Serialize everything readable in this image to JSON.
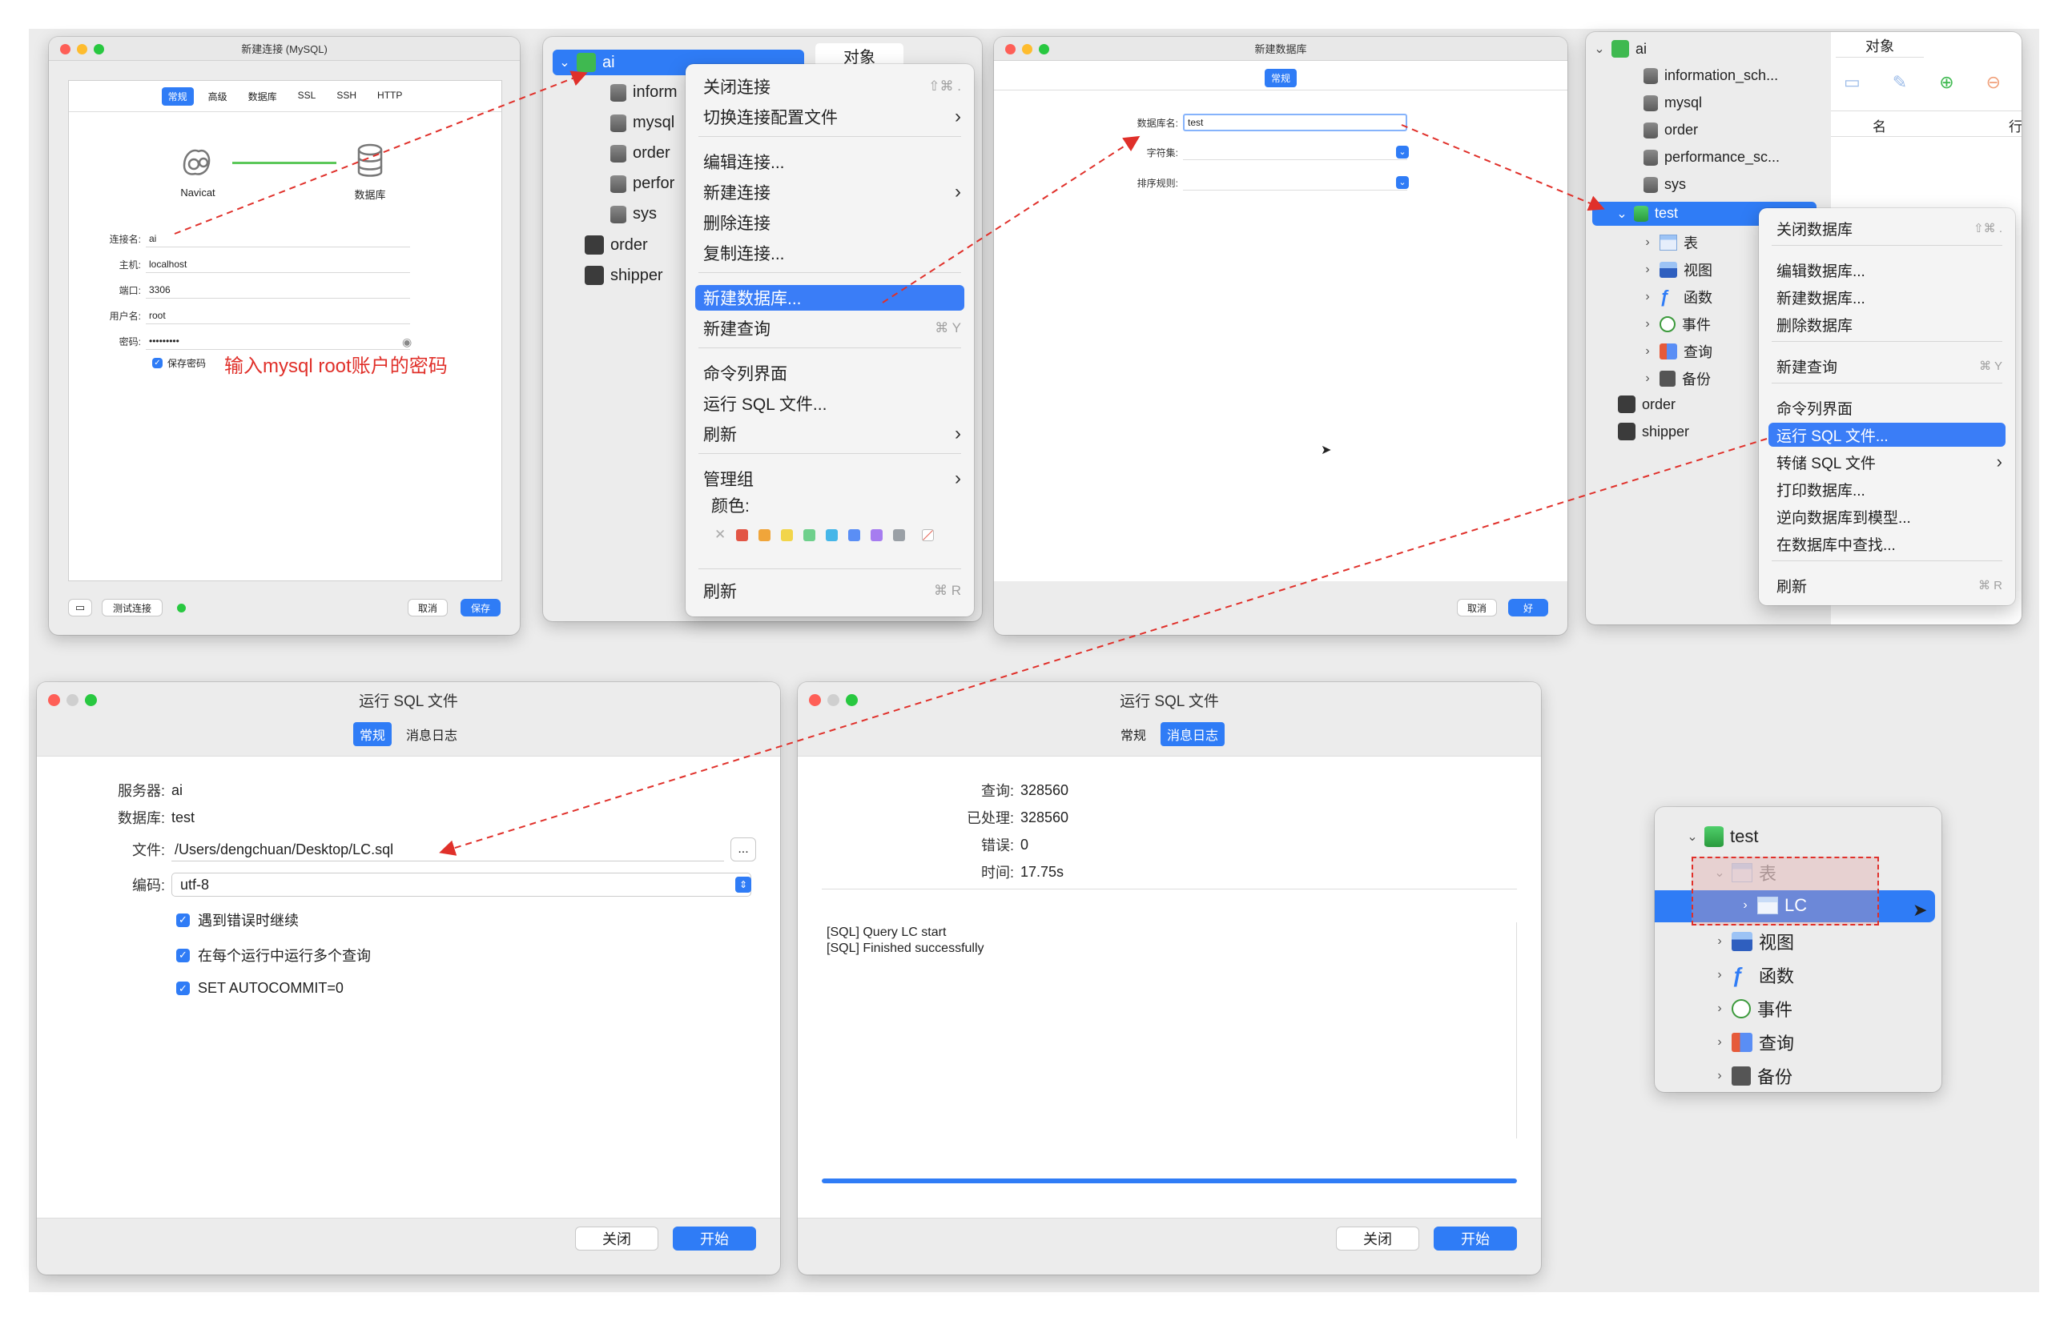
{
  "conn_dialog": {
    "title": "新建连接 (MySQL)",
    "tabs": [
      "常规",
      "高级",
      "数据库",
      "SSL",
      "SSH",
      "HTTP"
    ],
    "navicat_label": "Navicat",
    "db_label": "数据库",
    "fields": [
      {
        "label": "连接名:",
        "value": "ai"
      },
      {
        "label": "主机:",
        "value": "localhost"
      },
      {
        "label": "端口:",
        "value": "3306"
      },
      {
        "label": "用户名:",
        "value": "root"
      },
      {
        "label": "密码:",
        "value": "•••••••••"
      }
    ],
    "save_password": "保存密码",
    "annotation": "输入mysql root账户的密码",
    "test_button": "测试连接",
    "cancel_button": "取消",
    "save_button": "保存"
  },
  "tree1": {
    "root": "ai",
    "children": [
      "inform",
      "mysql",
      "order",
      "perfor",
      "sys"
    ],
    "others": [
      "order",
      "shipper"
    ],
    "tab": "对象"
  },
  "menu1": {
    "items": [
      {
        "label": "关闭连接",
        "shortcut": "⇧⌘ ."
      },
      {
        "label": "切换连接配置文件",
        "shortcut": "›"
      },
      {
        "label": "编辑连接...",
        "shortcut": ""
      },
      {
        "label": "新建连接",
        "shortcut": "›"
      },
      {
        "label": "删除连接",
        "shortcut": ""
      },
      {
        "label": "复制连接...",
        "shortcut": ""
      },
      {
        "label": "新建数据库...",
        "shortcut": ""
      },
      {
        "label": "新建查询",
        "shortcut": "⌘ Y"
      },
      {
        "label": "命令列界面",
        "shortcut": ""
      },
      {
        "label": "运行 SQL 文件...",
        "shortcut": ""
      },
      {
        "label": "刷新",
        "shortcut": "›"
      },
      {
        "label": "管理组",
        "shortcut": "›"
      }
    ],
    "color_label": "颜色:",
    "refresh": "刷新",
    "refresh_shortcut": "⌘ R",
    "colors": [
      "#e25545",
      "#f0a53a",
      "#f2d54a",
      "#6fd08c",
      "#45b6e8",
      "#5a8ef5",
      "#a67cf0",
      "#9aa0a6"
    ]
  },
  "newdb_dialog": {
    "title": "新建数据库",
    "tab": "常规",
    "fields": [
      {
        "label": "数据库名:",
        "value": "test"
      },
      {
        "label": "字符集:",
        "value": ""
      },
      {
        "label": "排序规则:",
        "value": ""
      }
    ],
    "cancel_button": "取消",
    "ok_button": "好"
  },
  "tree2": {
    "root": "ai",
    "children": [
      "information_sch...",
      "mysql",
      "order",
      "performance_sc...",
      "sys"
    ],
    "selected": "test",
    "sub": [
      "表",
      "视图",
      "函数",
      "事件",
      "查询",
      "备份"
    ],
    "others": [
      "order",
      "shipper"
    ],
    "tab": "对象",
    "col_name": "名",
    "col_row": "行"
  },
  "menu2": {
    "items": [
      {
        "label": "关闭数据库",
        "shortcut": "⇧⌘ ."
      },
      {
        "label": "编辑数据库...",
        "shortcut": ""
      },
      {
        "label": "新建数据库...",
        "shortcut": ""
      },
      {
        "label": "删除数据库",
        "shortcut": ""
      },
      {
        "label": "新建查询",
        "shortcut": "⌘ Y"
      },
      {
        "label": "命令列界面",
        "shortcut": ""
      },
      {
        "label": "运行 SQL 文件...",
        "shortcut": ""
      },
      {
        "label": "转储 SQL 文件",
        "shortcut": "›"
      },
      {
        "label": "打印数据库...",
        "shortcut": ""
      },
      {
        "label": "逆向数据库到模型...",
        "shortcut": ""
      },
      {
        "label": "在数据库中查找...",
        "shortcut": ""
      },
      {
        "label": "刷新",
        "shortcut": "⌘ R"
      }
    ]
  },
  "run_sql_1": {
    "title": "运行 SQL 文件",
    "tabs": [
      "常规",
      "消息日志"
    ],
    "server_label": "服务器:",
    "server": "ai",
    "db_label": "数据库:",
    "db": "test",
    "file_label": "文件:",
    "file": "/Users/dengchuan/Desktop/LC.sql",
    "browse": "...",
    "encoding_label": "编码:",
    "encoding": "utf-8",
    "options": [
      "遇到错误时继续",
      "在每个运行中运行多个查询",
      "SET AUTOCOMMIT=0"
    ],
    "close_button": "关闭",
    "start_button": "开始"
  },
  "run_sql_2": {
    "title": "运行 SQL 文件",
    "tabs": [
      "常规",
      "消息日志"
    ],
    "stats": [
      {
        "label": "查询:",
        "value": "328560"
      },
      {
        "label": "已处理:",
        "value": "328560"
      },
      {
        "label": "错误:",
        "value": "0"
      },
      {
        "label": "时间:",
        "value": "17.75s"
      }
    ],
    "log": [
      "[SQL] Query LC start",
      "[SQL] Finished successfully"
    ],
    "progress": 1.0,
    "close_button": "关闭",
    "start_button": "开始"
  },
  "tree3": {
    "root": "test",
    "table_group": "表",
    "selected": "LC",
    "sub": [
      "视图",
      "函数",
      "事件",
      "查询",
      "备份"
    ]
  }
}
